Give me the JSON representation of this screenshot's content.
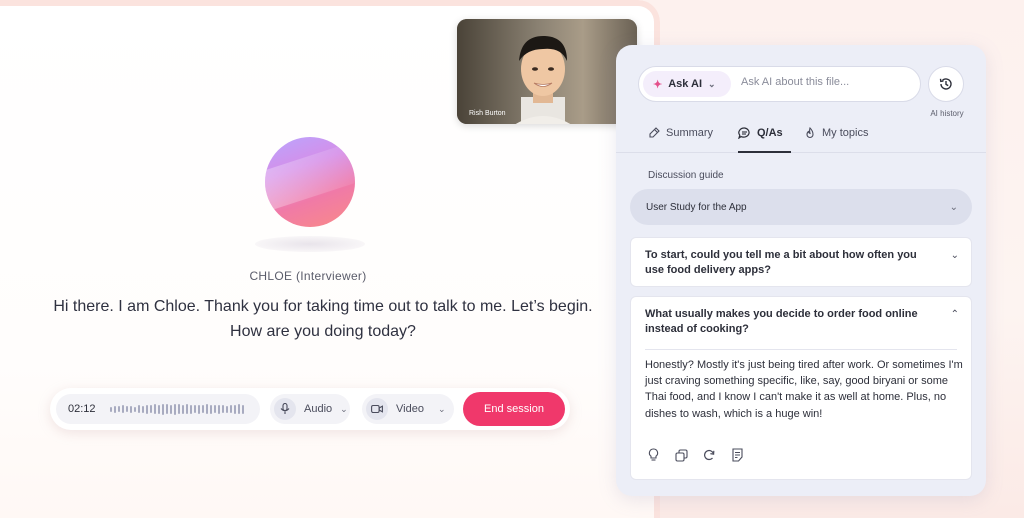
{
  "video": {
    "participant_name": "Rish Burton"
  },
  "interviewer": {
    "label": "CHLOE (Interviewer)",
    "message_line1": "Hi there. I am Chloe. Thank you for taking time out to talk to me. Let’s begin.",
    "message_line2": "How are you doing today?"
  },
  "controls": {
    "timer": "02:12",
    "audio_label": "Audio",
    "video_label": "Video",
    "end_label": "End session",
    "end_color": "#f0386b"
  },
  "ai_panel": {
    "ask_chip_label": "Ask AI",
    "ask_placeholder": "Ask AI about this file...",
    "history_label": "AI history",
    "tabs": [
      {
        "label": "Summary",
        "icon": "summary-icon"
      },
      {
        "label": "Q/As",
        "icon": "chat-icon"
      },
      {
        "label": "My topics",
        "icon": "flame-icon"
      }
    ],
    "active_tab": "Q/As",
    "guide_label": "Discussion guide",
    "guide_selected": "User Study for the App",
    "qa": [
      {
        "question": "To start, could you tell me a bit about how often you use food delivery apps?",
        "expanded": false
      },
      {
        "question": "What usually makes you decide to order food online instead of cooking?",
        "expanded": true,
        "answer": "Honestly? Mostly it's just being tired after work. Or sometimes I'm just craving something specific, like, say, good biryani or some Thai food, and I know I can't make it as well at home. Plus, no dishes to wash, which is a huge win!"
      }
    ]
  }
}
